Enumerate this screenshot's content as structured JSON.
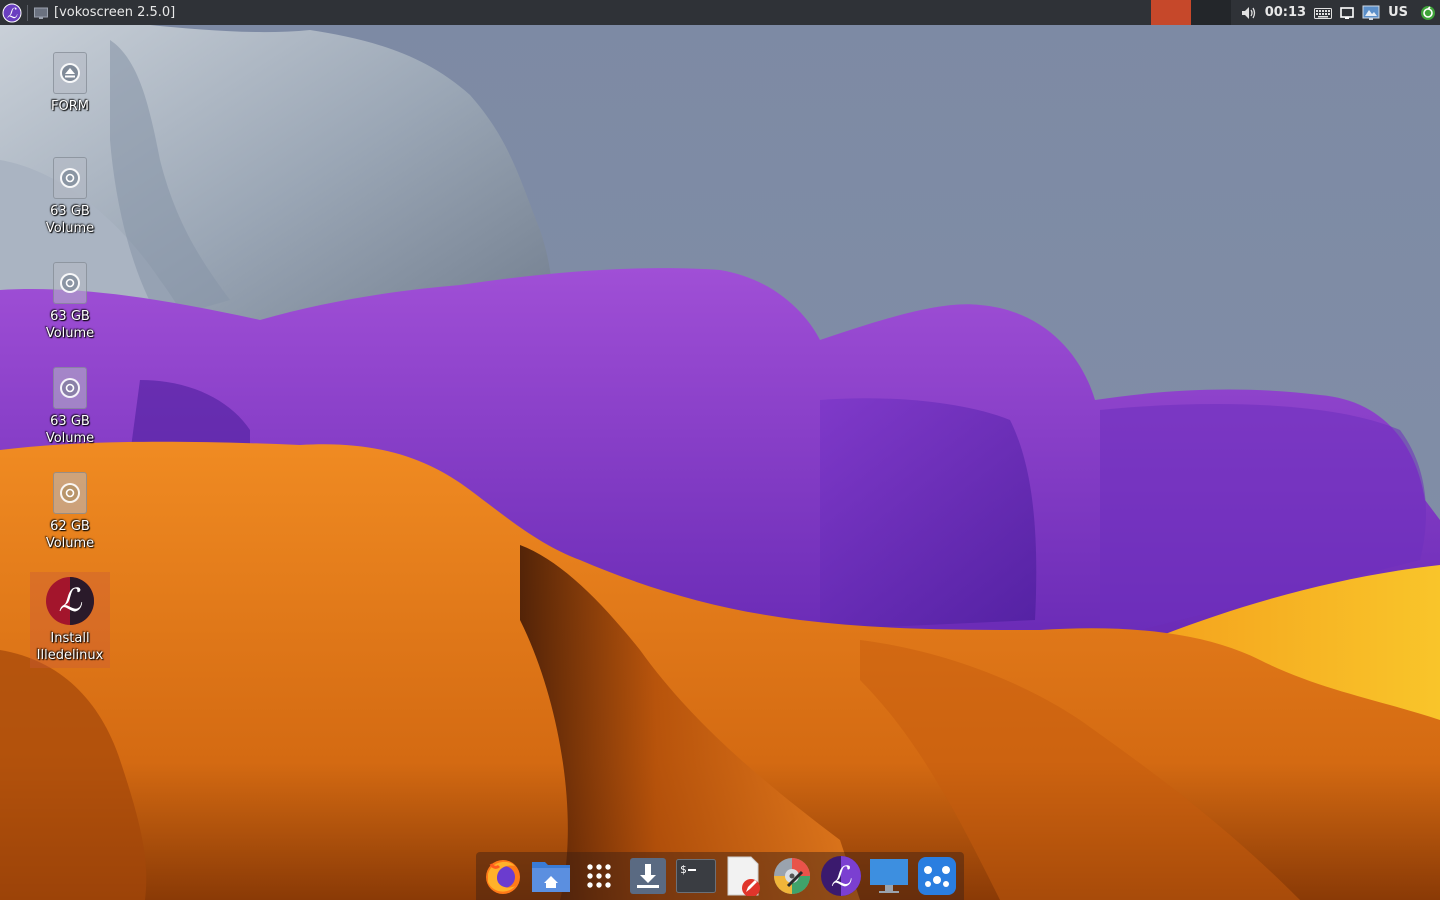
{
  "panel": {
    "window_title": "[vokoscreen 2.5.0]",
    "clock": "00:13",
    "keyboard_layout": "US",
    "workspace_active_color": "#c6482a",
    "icons": {
      "menu": "lilidelinux-logo-icon",
      "volume": "speaker-icon",
      "keyboard": "keyboard-icon",
      "display": "display-icon",
      "network": "network-icon",
      "updates": "update-icon"
    }
  },
  "desktop": {
    "items": [
      {
        "label": "FORM",
        "icon": "eject-drive-icon"
      },
      {
        "label_line1": "63 GB",
        "label_line2": "Volume",
        "icon": "drive-icon"
      },
      {
        "label_line1": "63 GB",
        "label_line2": "Volume",
        "icon": "drive-icon"
      },
      {
        "label_line1": "63 GB",
        "label_line2": "Volume",
        "icon": "drive-icon"
      },
      {
        "label_line1": "62 GB",
        "label_line2": "Volume",
        "icon": "drive-icon"
      },
      {
        "label_line1": "Install",
        "label_line2": "Illedelinux",
        "icon": "install-logo-icon"
      }
    ]
  },
  "dock": {
    "items": [
      "firefox-icon",
      "home-folder-icon",
      "app-grid-icon",
      "downloads-icon",
      "terminal-icon",
      "text-editor-icon",
      "disk-utility-icon",
      "lilidelinux-icon",
      "monitor-icon",
      "settings-mixer-icon"
    ]
  },
  "colors": {
    "panel_bg": "#2f3237",
    "sky": "#7a88a3",
    "orange": "#e67d1f",
    "purple": "#8a3fc7",
    "grey_rock": "#9aa8b8"
  }
}
